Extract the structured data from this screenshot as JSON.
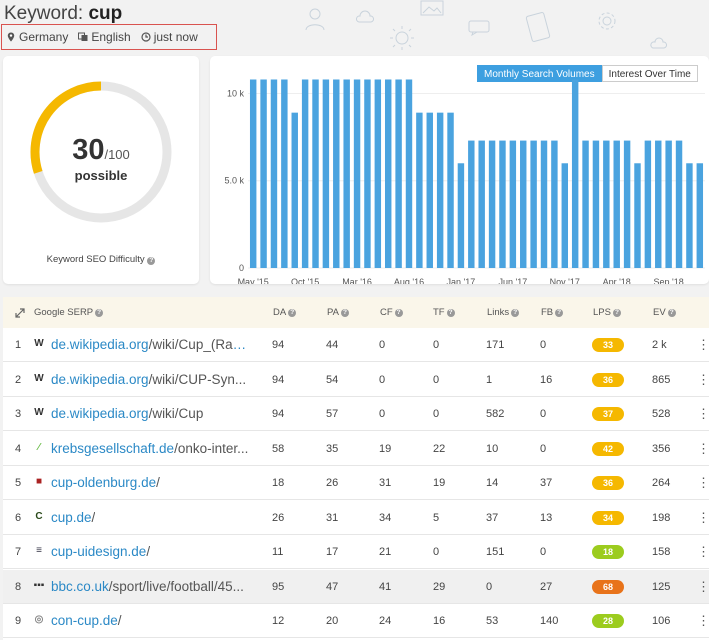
{
  "header": {
    "keyword_prefix": "Keyword:",
    "keyword": "cup",
    "location": "Germany",
    "language": "English",
    "updated": "just now"
  },
  "difficulty": {
    "score": "30",
    "max": "/100",
    "score_value": 30,
    "label": "possible",
    "caption": "Keyword SEO Difficulty",
    "colors": {
      "fill": "#f5b800",
      "track": "#e6e6e6"
    }
  },
  "chart_toggle": {
    "volumes": "Monthly Search Volumes",
    "interest": "Interest Over Time"
  },
  "chart_data": {
    "type": "bar",
    "yticks": [
      "10 k",
      "5.0 k",
      "0"
    ],
    "ytick_values": [
      10000,
      5000,
      0
    ],
    "ylim": [
      0,
      11000
    ],
    "xtick_labels": [
      "May '15",
      "Oct '15",
      "Mar '16",
      "Aug '16",
      "Jan '17",
      "Jun '17",
      "Nov '17",
      "Apr '18",
      "Sep '18"
    ],
    "xtick_indices": [
      0,
      5,
      10,
      15,
      20,
      25,
      30,
      35,
      40
    ],
    "values": [
      10800,
      10800,
      10800,
      10800,
      8900,
      10800,
      10800,
      10800,
      10800,
      10800,
      10800,
      10800,
      10800,
      10800,
      10800,
      10800,
      8900,
      8900,
      8900,
      8900,
      6000,
      7300,
      7300,
      7300,
      7300,
      7300,
      7300,
      7300,
      7300,
      7300,
      6000,
      10800,
      7300,
      7300,
      7300,
      7300,
      7300,
      6000,
      7300,
      7300,
      7300,
      7300,
      6000,
      6000
    ],
    "color": "#4aa3df"
  },
  "table": {
    "headers": {
      "serp": "Google SERP",
      "da": "DA",
      "pa": "PA",
      "cf": "CF",
      "tf": "TF",
      "links": "Links",
      "fb": "FB",
      "lps": "LPS",
      "ev": "EV"
    },
    "rows": [
      {
        "n": "1",
        "domain": "de.wikipedia.org",
        "path": "/wiki/Cup_(Rau...",
        "fav": "W",
        "favcolor": "#333",
        "da": "94",
        "pa": "44",
        "cf": "0",
        "tf": "0",
        "links": "171",
        "fb": "0",
        "lps": "33",
        "lpscolor": "#f5b800",
        "ev": "2 k"
      },
      {
        "n": "2",
        "domain": "de.wikipedia.org",
        "path": "/wiki/CUP-Syn...",
        "fav": "W",
        "favcolor": "#333",
        "da": "94",
        "pa": "54",
        "cf": "0",
        "tf": "0",
        "links": "1",
        "fb": "16",
        "lps": "36",
        "lpscolor": "#f5b800",
        "ev": "865"
      },
      {
        "n": "3",
        "domain": "de.wikipedia.org",
        "path": "/wiki/Cup",
        "fav": "W",
        "favcolor": "#333",
        "da": "94",
        "pa": "57",
        "cf": "0",
        "tf": "0",
        "links": "582",
        "fb": "0",
        "lps": "37",
        "lpscolor": "#f5b800",
        "ev": "528"
      },
      {
        "n": "4",
        "domain": "krebsgesellschaft.de",
        "path": "/onko-inter...",
        "fav": "⁄",
        "favcolor": "#6b4",
        "da": "58",
        "pa": "35",
        "cf": "19",
        "tf": "22",
        "links": "10",
        "fb": "0",
        "lps": "42",
        "lpscolor": "#f5b800",
        "ev": "356"
      },
      {
        "n": "5",
        "domain": "cup-oldenburg.de",
        "path": "/",
        "fav": "■",
        "favcolor": "#a22",
        "da": "18",
        "pa": "26",
        "cf": "31",
        "tf": "19",
        "links": "14",
        "fb": "37",
        "lps": "36",
        "lpscolor": "#f5b800",
        "ev": "264"
      },
      {
        "n": "6",
        "domain": "cup.de",
        "path": "/",
        "fav": "C",
        "favcolor": "#2a4a1a",
        "da": "26",
        "pa": "31",
        "cf": "34",
        "tf": "5",
        "links": "37",
        "fb": "13",
        "lps": "34",
        "lpscolor": "#f5b800",
        "ev": "198"
      },
      {
        "n": "7",
        "domain": "cup-uidesign.de",
        "path": "/",
        "fav": "≡",
        "favcolor": "#334",
        "da": "11",
        "pa": "17",
        "cf": "21",
        "tf": "0",
        "links": "151",
        "fb": "0",
        "lps": "18",
        "lpscolor": "#9ccc1e",
        "ev": "158"
      },
      {
        "n": "8",
        "domain": "bbc.co.uk",
        "path": "/sport/live/football/45...",
        "fav": "▪▪▪",
        "favcolor": "#333",
        "da": "95",
        "pa": "47",
        "cf": "41",
        "tf": "29",
        "links": "0",
        "fb": "27",
        "lps": "68",
        "lpscolor": "#e8731a",
        "ev": "125"
      },
      {
        "n": "9",
        "domain": "con-cup.de",
        "path": "/",
        "fav": "◎",
        "favcolor": "#888",
        "da": "12",
        "pa": "20",
        "cf": "24",
        "tf": "16",
        "links": "53",
        "fb": "140",
        "lps": "28",
        "lpscolor": "#9ccc1e",
        "ev": "106"
      }
    ]
  }
}
